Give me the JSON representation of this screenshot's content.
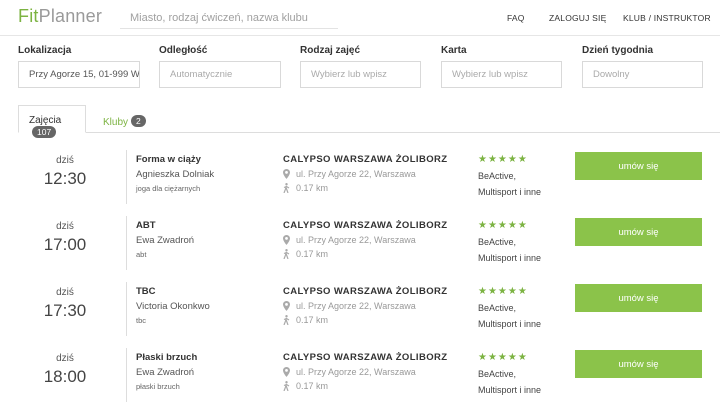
{
  "header": {
    "logo_fit": "Fit",
    "logo_planner": "Planner",
    "search_placeholder": "Miasto, rodzaj ćwiczeń, nazwa klubu",
    "nav": [
      "FAQ",
      "ZALOGUJ SIĘ",
      "KLUB / INSTRUKTOR"
    ]
  },
  "filters": [
    {
      "label": "Lokalizacja",
      "value": "Przy Agorze 15, 01-999 W",
      "placeholder": ""
    },
    {
      "label": "Odległość",
      "value": "",
      "placeholder": "Automatycznie"
    },
    {
      "label": "Rodzaj zajęć",
      "value": "",
      "placeholder": "Wybierz lub wpisz"
    },
    {
      "label": "Karta",
      "value": "",
      "placeholder": "Wybierz lub wpisz"
    },
    {
      "label": "Dzień tygodnia",
      "value": "",
      "placeholder": "Dowolny"
    }
  ],
  "tabs": [
    {
      "label": "Zajęcia",
      "count": "107"
    },
    {
      "label": "Kluby",
      "count": "2"
    }
  ],
  "rows": [
    {
      "day": "dziś",
      "time": "12:30",
      "name": "Forma w ciąży",
      "instructor": "Agnieszka Dolniak",
      "type": "joga dla ciężarnych",
      "club": "CALYPSO WARSZAWA ŻOLIBORZ",
      "address": "ul. Przy Agorze 22, Warszawa",
      "distance": "0.17 km",
      "stars": "★★★★★",
      "cards1": "BeActive,",
      "cards2": "Multisport i inne",
      "button": "umów się"
    },
    {
      "day": "dziś",
      "time": "17:00",
      "name": "ABT",
      "instructor": "Ewa Zwadroń",
      "type": "abt",
      "club": "CALYPSO WARSZAWA ŻOLIBORZ",
      "address": "ul. Przy Agorze 22, Warszawa",
      "distance": "0.17 km",
      "stars": "★★★★★",
      "cards1": "BeActive,",
      "cards2": "Multisport i inne",
      "button": "umów się"
    },
    {
      "day": "dziś",
      "time": "17:30",
      "name": "TBC",
      "instructor": "Victoria Okonkwo",
      "type": "tbc",
      "club": "CALYPSO WARSZAWA ŻOLIBORZ",
      "address": "ul. Przy Agorze 22, Warszawa",
      "distance": "0.17 km",
      "stars": "★★★★★",
      "cards1": "BeActive,",
      "cards2": "Multisport i inne",
      "button": "umów się"
    },
    {
      "day": "dziś",
      "time": "18:00",
      "name": "Płaski brzuch",
      "instructor": "Ewa Zwadroń",
      "type": "płaski brzuch",
      "club": "CALYPSO WARSZAWA ŻOLIBORZ",
      "address": "ul. Przy Agorze 22, Warszawa",
      "distance": "0.17 km",
      "stars": "★★★★★",
      "cards1": "BeActive,",
      "cards2": "Multisport i inne",
      "button": "umów się"
    }
  ]
}
